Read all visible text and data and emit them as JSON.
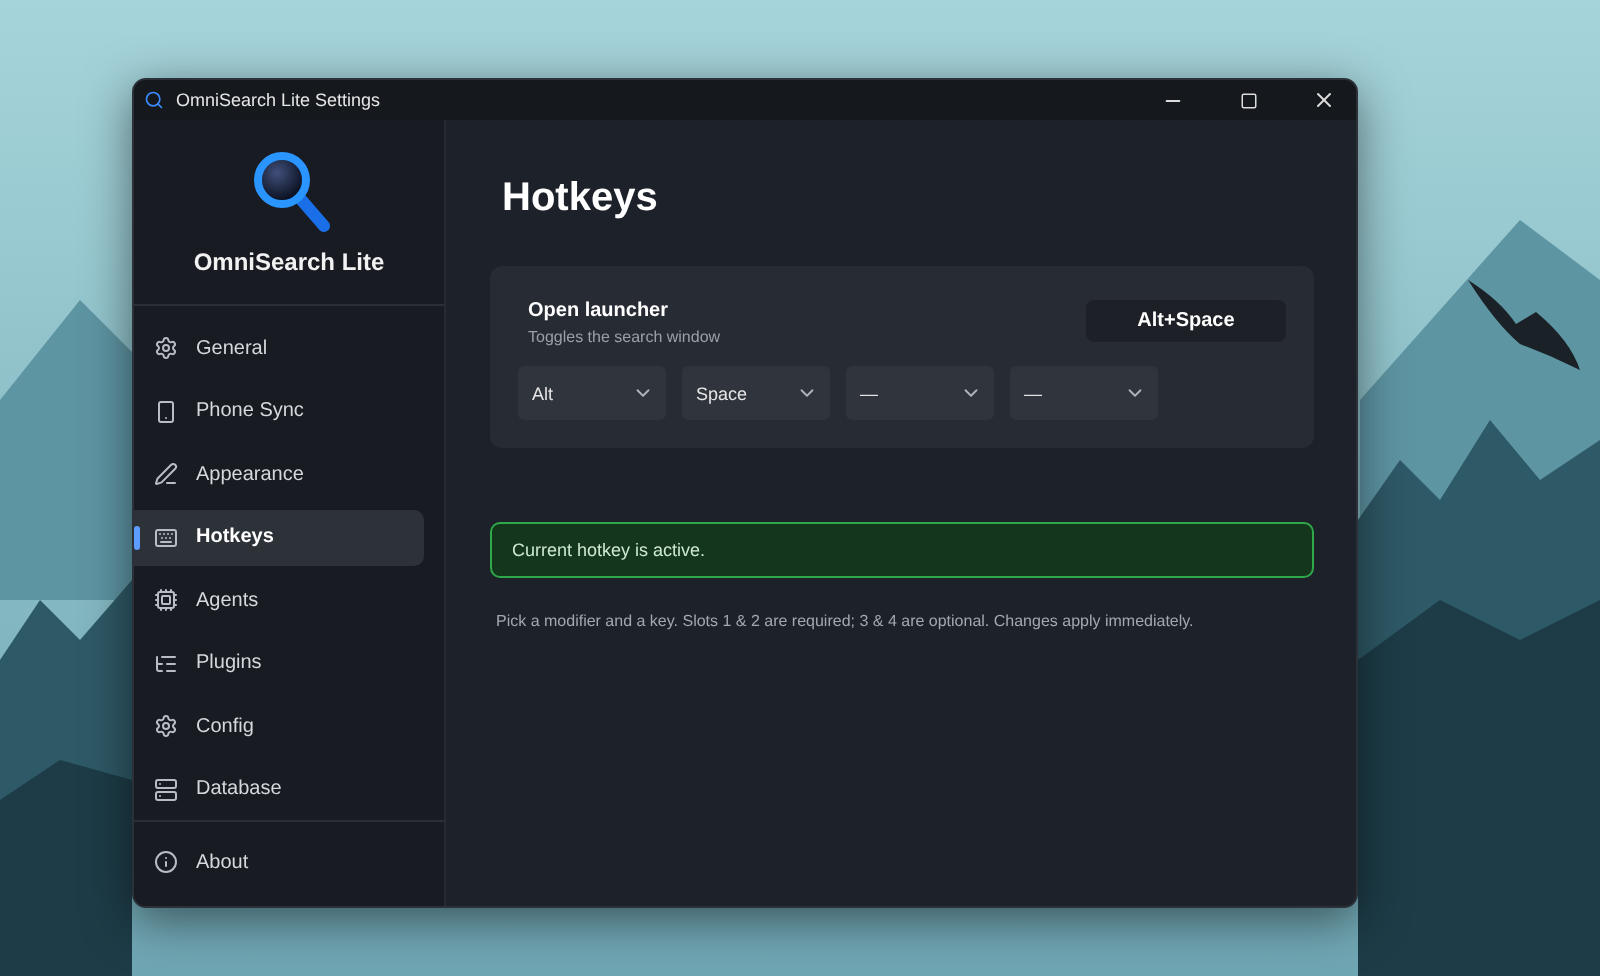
{
  "window": {
    "title": "OmniSearch Lite Settings"
  },
  "sidebar": {
    "app_name": "OmniSearch Lite",
    "items": [
      {
        "label": "General",
        "selected": false
      },
      {
        "label": "Phone Sync",
        "selected": false
      },
      {
        "label": "Appearance",
        "selected": false
      },
      {
        "label": "Hotkeys",
        "selected": true
      },
      {
        "label": "Agents",
        "selected": false
      },
      {
        "label": "Plugins",
        "selected": false
      },
      {
        "label": "Config",
        "selected": false
      },
      {
        "label": "Database",
        "selected": false
      }
    ],
    "footer_item": {
      "label": "About",
      "selected": false
    }
  },
  "page": {
    "title": "Hotkeys",
    "hotkey": {
      "name": "Open launcher",
      "description": "Toggles the search window",
      "current": "Alt+Space",
      "slots": [
        {
          "value": "Alt"
        },
        {
          "value": "Space"
        },
        {
          "value": "—"
        },
        {
          "value": "—"
        }
      ]
    },
    "status": {
      "kind": "success",
      "text": "Current hotkey is active."
    },
    "hint": "Pick a modifier and a key. Slots 1 & 2 are required; 3 & 4 are optional. Changes apply immediately."
  }
}
